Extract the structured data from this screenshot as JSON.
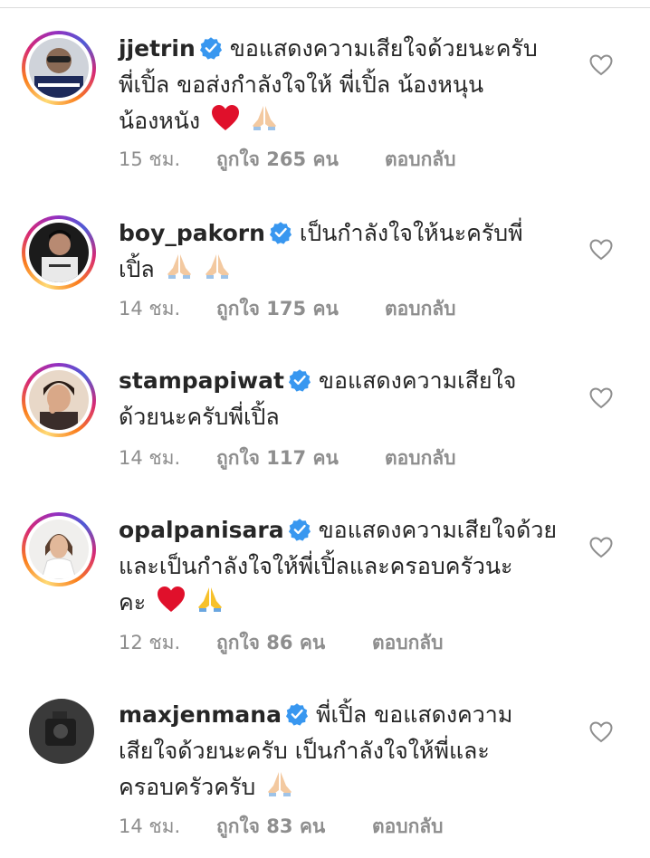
{
  "comments": [
    {
      "username": "jjetrin",
      "text_line1": "ขอแสดงความเสียใจด้วยนะครับ",
      "text_line2": "พี่เปิ้ล  ขอส่งกำลังใจให้ พี่เปิ้ล น้องหนุน",
      "text_line3": "น้องหนัง",
      "time": "15 ชม.",
      "likes": "ถูกใจ 265 คน",
      "reply": "ตอบกลับ"
    },
    {
      "username": "boy_pakorn",
      "text_line1": "เป็นกำลังใจให้นะครับพี่",
      "text_line2": "เปิ้ล",
      "time": "14 ชม.",
      "likes": "ถูกใจ 175 คน",
      "reply": "ตอบกลับ"
    },
    {
      "username": "stampapiwat",
      "text_line1": "ขอแสดงความเสียใจ",
      "text_line2": "ด้วยนะครับพี่เปิ้ล",
      "time": "14 ชม.",
      "likes": "ถูกใจ 117 คน",
      "reply": "ตอบกลับ"
    },
    {
      "username": "opalpanisara",
      "text_line1": "ขอแสดงความเสียใจด้วย",
      "text_line2": "และเป็นกำลังใจให้พี่เปิ้ลและครอบครัวนะ",
      "text_line3": "คะ",
      "time": "12 ชม.",
      "likes": "ถูกใจ 86 คน",
      "reply": "ตอบกลับ"
    },
    {
      "username": "maxjenmana",
      "text_line1": "พี่เปิ้ล ขอแสดงความ",
      "text_line2": "เสียใจด้วยนะครับ เป็นกำลังใจให้พี่และ",
      "text_line3": "ครอบครัวครับ",
      "time": "14 ชม.",
      "likes": "ถูกใจ 83 คน",
      "reply": "ตอบกลับ"
    }
  ],
  "icons": {
    "verified": "verified-badge-icon",
    "like": "heart-outline-icon",
    "emoji_heart": "red-heart-emoji",
    "emoji_pray": "folded-hands-emoji"
  },
  "colors": {
    "verified_blue": "#3897f0",
    "meta_gray": "#8e8e8e",
    "text": "#262626",
    "heart_red": "#e0102b",
    "pray_skin": "#f3c9a0",
    "pray_yellow": "#f7c12b"
  }
}
